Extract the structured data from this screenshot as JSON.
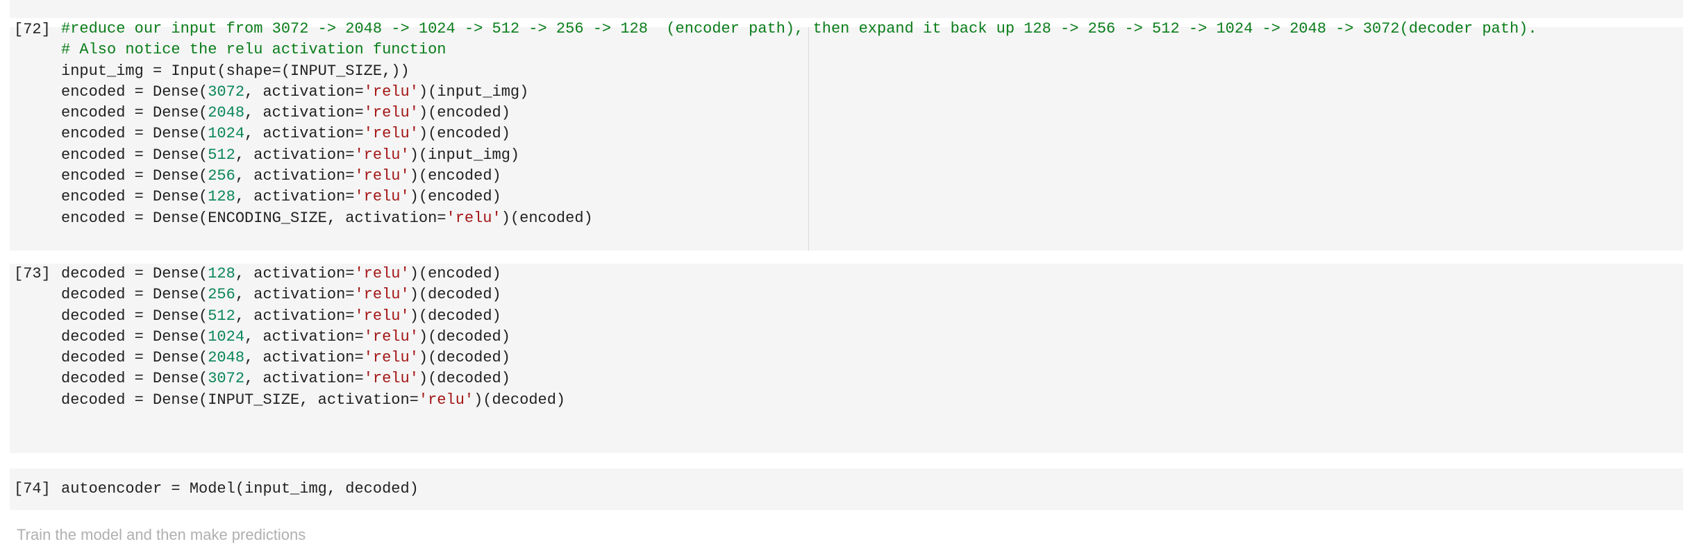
{
  "cells": [
    {
      "prompt": "[72]",
      "lines": [
        [
          {
            "t": "#reduce our input from 3072 -> 2048 -> 1024 -> 512 -> 256 -> 128  (encoder path), then expand it back up 128 -> 256 -> 512 -> 1024 -> 2048 -> 3072(decoder path).",
            "k": "cmt"
          }
        ],
        [
          {
            "t": "# Also notice the relu activation function",
            "k": "cmt"
          }
        ],
        [
          {
            "t": "input_img = Input(shape=(INPUT_SIZE,))",
            "k": "plain"
          }
        ],
        [
          {
            "t": "encoded = Dense(",
            "k": "plain"
          },
          {
            "t": "3072",
            "k": "num"
          },
          {
            "t": ", activation=",
            "k": "plain"
          },
          {
            "t": "'relu'",
            "k": "str"
          },
          {
            "t": ")(input_img)",
            "k": "plain"
          }
        ],
        [
          {
            "t": "encoded = Dense(",
            "k": "plain"
          },
          {
            "t": "2048",
            "k": "num"
          },
          {
            "t": ", activation=",
            "k": "plain"
          },
          {
            "t": "'relu'",
            "k": "str"
          },
          {
            "t": ")(encoded)",
            "k": "plain"
          }
        ],
        [
          {
            "t": "encoded = Dense(",
            "k": "plain"
          },
          {
            "t": "1024",
            "k": "num"
          },
          {
            "t": ", activation=",
            "k": "plain"
          },
          {
            "t": "'relu'",
            "k": "str"
          },
          {
            "t": ")(encoded)",
            "k": "plain"
          }
        ],
        [
          {
            "t": "encoded = Dense(",
            "k": "plain"
          },
          {
            "t": "512",
            "k": "num"
          },
          {
            "t": ", activation=",
            "k": "plain"
          },
          {
            "t": "'relu'",
            "k": "str"
          },
          {
            "t": ")(input_img)",
            "k": "plain"
          }
        ],
        [
          {
            "t": "encoded = Dense(",
            "k": "plain"
          },
          {
            "t": "256",
            "k": "num"
          },
          {
            "t": ", activation=",
            "k": "plain"
          },
          {
            "t": "'relu'",
            "k": "str"
          },
          {
            "t": ")(encoded)",
            "k": "plain"
          }
        ],
        [
          {
            "t": "encoded = Dense(",
            "k": "plain"
          },
          {
            "t": "128",
            "k": "num"
          },
          {
            "t": ", activation=",
            "k": "plain"
          },
          {
            "t": "'relu'",
            "k": "str"
          },
          {
            "t": ")(encoded)",
            "k": "plain"
          }
        ],
        [
          {
            "t": "encoded = Dense(ENCODING_SIZE, activation=",
            "k": "plain"
          },
          {
            "t": "'relu'",
            "k": "str"
          },
          {
            "t": ")(encoded)",
            "k": "plain"
          }
        ]
      ]
    },
    {
      "prompt": "[73]",
      "lines": [
        [
          {
            "t": "decoded = Dense(",
            "k": "plain"
          },
          {
            "t": "128",
            "k": "num"
          },
          {
            "t": ", activation=",
            "k": "plain"
          },
          {
            "t": "'relu'",
            "k": "str"
          },
          {
            "t": ")(encoded)",
            "k": "plain"
          }
        ],
        [
          {
            "t": "decoded = Dense(",
            "k": "plain"
          },
          {
            "t": "256",
            "k": "num"
          },
          {
            "t": ", activation=",
            "k": "plain"
          },
          {
            "t": "'relu'",
            "k": "str"
          },
          {
            "t": ")(decoded)",
            "k": "plain"
          }
        ],
        [
          {
            "t": "decoded = Dense(",
            "k": "plain"
          },
          {
            "t": "512",
            "k": "num"
          },
          {
            "t": ", activation=",
            "k": "plain"
          },
          {
            "t": "'relu'",
            "k": "str"
          },
          {
            "t": ")(decoded)",
            "k": "plain"
          }
        ],
        [
          {
            "t": "decoded = Dense(",
            "k": "plain"
          },
          {
            "t": "1024",
            "k": "num"
          },
          {
            "t": ", activation=",
            "k": "plain"
          },
          {
            "t": "'relu'",
            "k": "str"
          },
          {
            "t": ")(decoded)",
            "k": "plain"
          }
        ],
        [
          {
            "t": "decoded = Dense(",
            "k": "plain"
          },
          {
            "t": "2048",
            "k": "num"
          },
          {
            "t": ", activation=",
            "k": "plain"
          },
          {
            "t": "'relu'",
            "k": "str"
          },
          {
            "t": ")(decoded)",
            "k": "plain"
          }
        ],
        [
          {
            "t": "decoded = Dense(",
            "k": "plain"
          },
          {
            "t": "3072",
            "k": "num"
          },
          {
            "t": ", activation=",
            "k": "plain"
          },
          {
            "t": "'relu'",
            "k": "str"
          },
          {
            "t": ")(decoded)",
            "k": "plain"
          }
        ],
        [
          {
            "t": "decoded = Dense(INPUT_SIZE, activation=",
            "k": "plain"
          },
          {
            "t": "'relu'",
            "k": "str"
          },
          {
            "t": ")(decoded)",
            "k": "plain"
          }
        ]
      ]
    },
    {
      "prompt": "[74]",
      "lines": [
        [
          {
            "t": "autoencoder = Model(input_img, decoded)",
            "k": "plain"
          }
        ]
      ]
    }
  ],
  "colors": {
    "comment": "#0a7d1a",
    "number": "#098658",
    "string": "#a31515",
    "text": "#212121",
    "cell_bg": "#f5f5f5"
  },
  "footer_text_partial": "Train the model and then make predictions"
}
